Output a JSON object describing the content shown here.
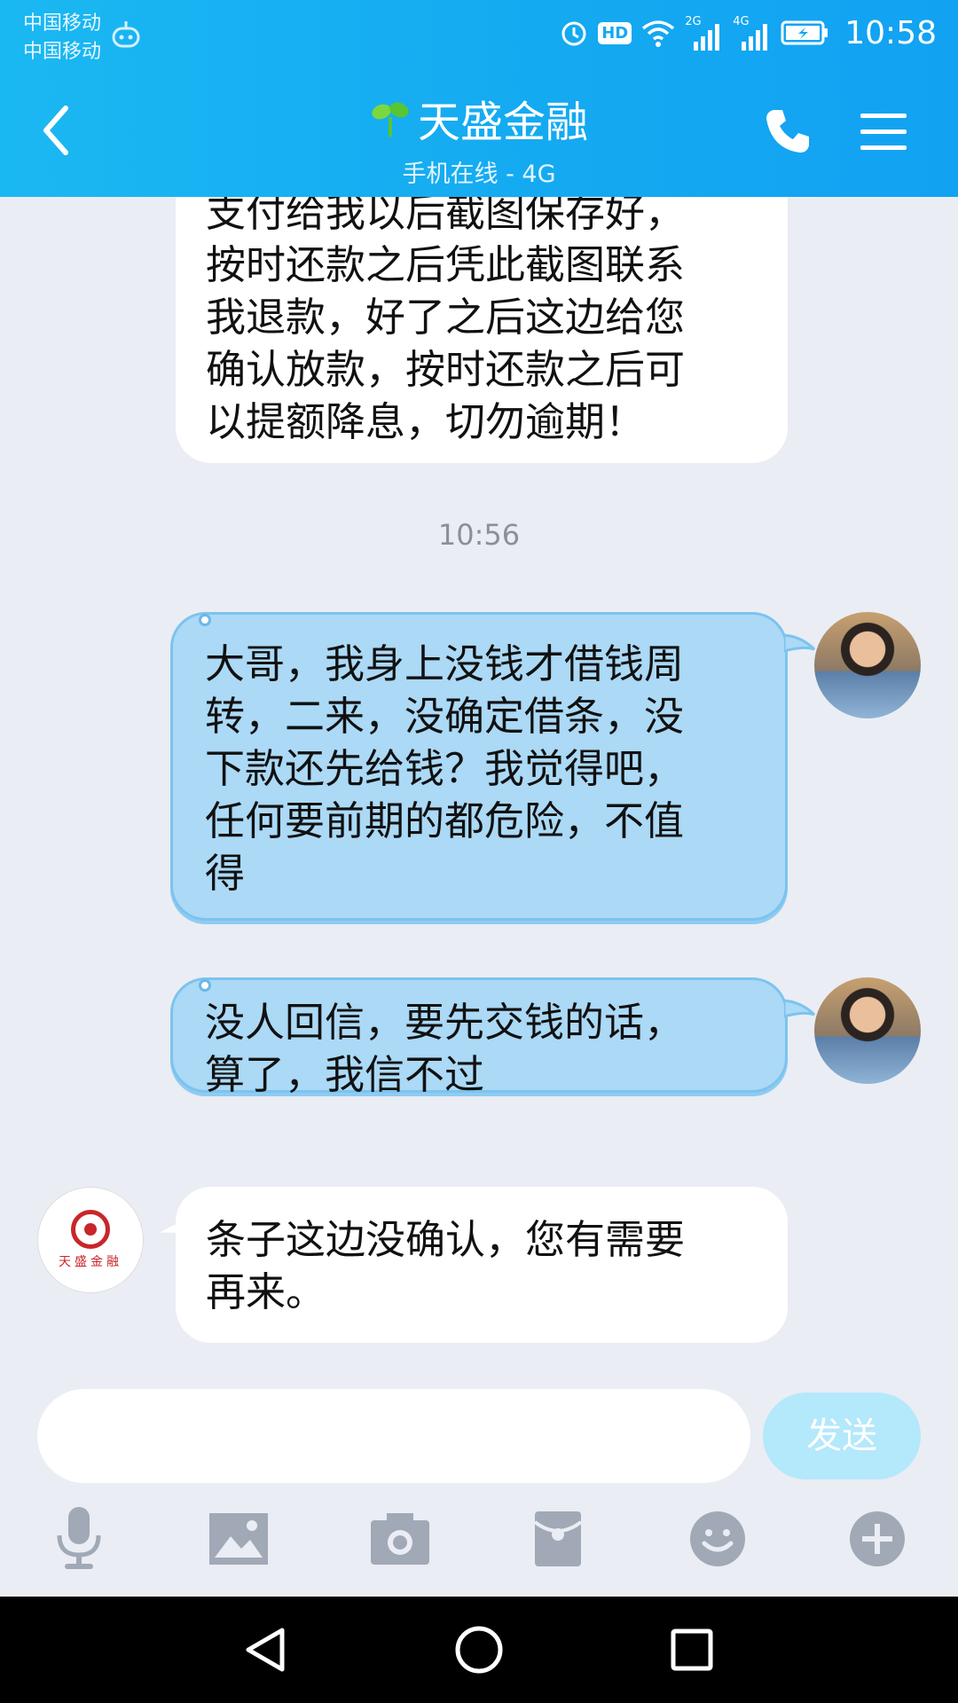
{
  "status_bar": {
    "carrier_1": "中国移动",
    "carrier_2": "中国移动",
    "hd_badge": "HD",
    "net_1": "2G",
    "net_2": "4G",
    "time": "10:58",
    "icons": [
      "robot-icon",
      "alarm-icon",
      "hd-icon",
      "wifi-icon",
      "signal-icon",
      "signal-icon",
      "battery-icon"
    ]
  },
  "header": {
    "title": "天盛金融",
    "subtitle": "手机在线 - 4G",
    "icons": [
      "back-icon",
      "sprout-icon",
      "phone-icon",
      "menu-icon"
    ],
    "accent": "#14a9f1"
  },
  "messages": [
    {
      "side": "in",
      "text": "支付给我以后截图保存好，\n按时还款之后凭此截图联系\n我退款，好了之后这边给您\n确认放款，按时还款之后可\n以提额降息，切勿逾期！"
    },
    {
      "side": "out",
      "text": "大哥，我身上没钱才借钱周\n转，二来，没确定借条，没\n下款还先给钱？我觉得吧，\n任何要前期的都危险，不值\n得"
    },
    {
      "side": "out",
      "text": "没人回信，要先交钱的话，\n算了，我信不过"
    },
    {
      "side": "in",
      "text": "条子这边没确认，您有需要\n再来。"
    }
  ],
  "timestamp": "10:56",
  "biz_avatar_text": "天盛金融",
  "input": {
    "value": "",
    "placeholder": "",
    "send_label": "发送"
  },
  "toolbar_icons": [
    "microphone-icon",
    "image-icon",
    "camera-icon",
    "red-packet-icon",
    "emoji-icon",
    "plus-icon"
  ],
  "nav_icons": [
    "back-triangle-icon",
    "home-circle-icon",
    "recents-square-icon"
  ],
  "colors": {
    "incoming_bubble": "#ffffff",
    "outgoing_bubble": "#abd9f6",
    "send_button": "#b4e8fb",
    "background": "#eaedf4"
  }
}
